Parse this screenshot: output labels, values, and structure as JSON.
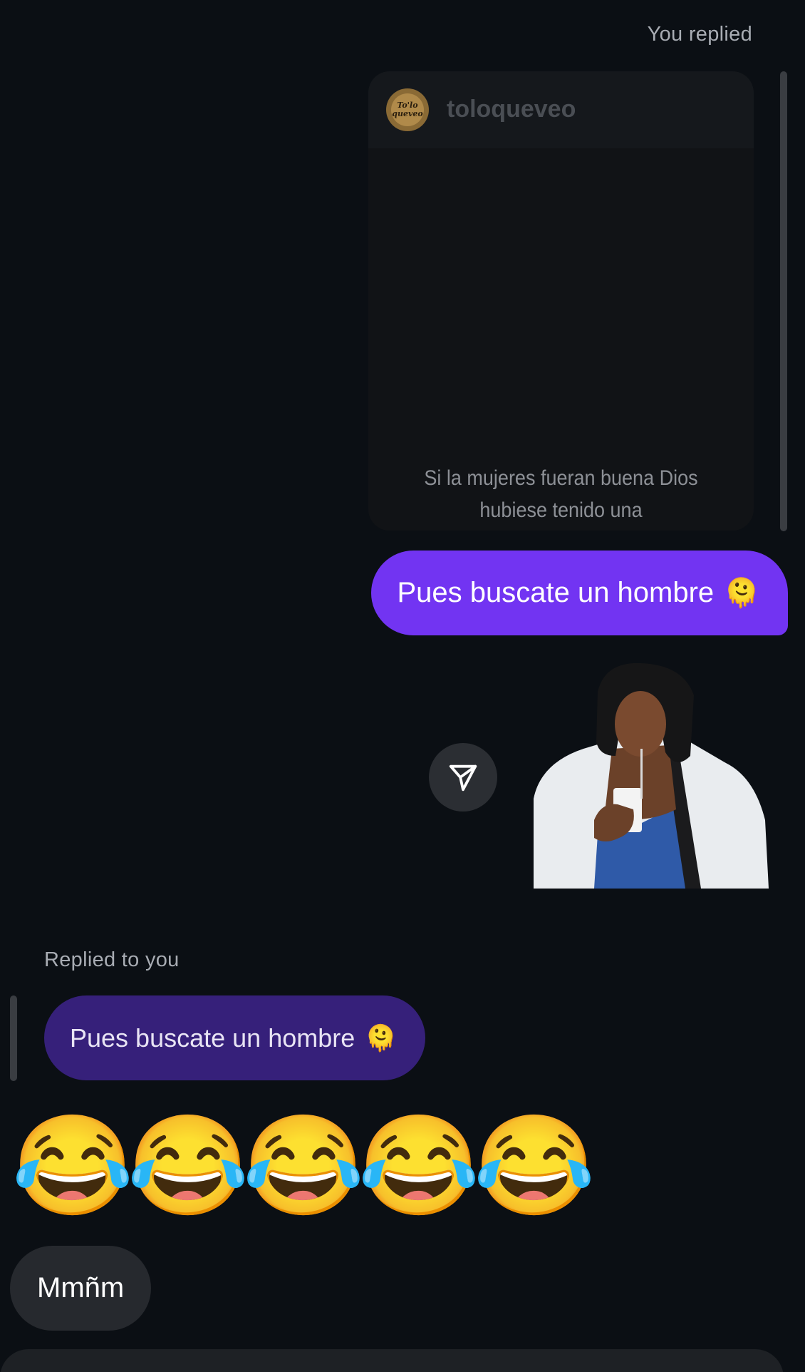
{
  "thread": {
    "sent_reply_label": "You replied",
    "story": {
      "username": "toloqueveo",
      "avatar_text": "To'lo queveo",
      "caption": "Si la mujeres fueran buena Dios hubiese tenido una"
    },
    "sent_message": "Pues buscate un hombre",
    "sent_message_emoji": "🫠",
    "received_reply_label": "Replied to you",
    "quoted_message": "Pues buscate un hombre",
    "quoted_message_emoji": "🫠",
    "emoji_message": [
      "😂",
      "😂",
      "😂",
      "😂",
      "😂"
    ],
    "received_message": "Mmñm"
  },
  "colors": {
    "background": "#0b0f14",
    "sent_bubble": "#7234f2",
    "quoted_bubble": "#36207a",
    "received_bubble": "#26292e"
  },
  "icons": {
    "share": "paper-plane-icon"
  }
}
